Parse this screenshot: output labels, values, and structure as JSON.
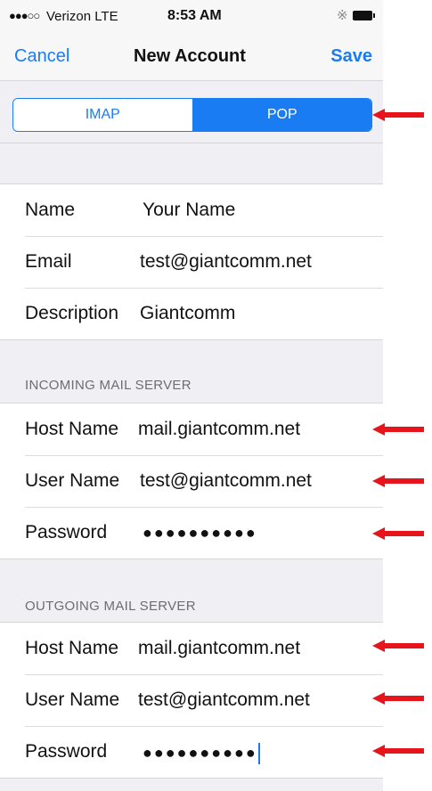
{
  "status": {
    "signal": "●●●○○",
    "carrier": "Verizon  LTE",
    "time": "8:53 AM",
    "bluetooth_icon": "bluetooth-icon",
    "battery_icon": "battery-icon"
  },
  "nav": {
    "cancel": "Cancel",
    "title": "New Account",
    "save": "Save"
  },
  "segment": {
    "options": [
      "IMAP",
      "POP"
    ],
    "selected": "POP"
  },
  "account": {
    "name_label": "Name",
    "name_value": "Your Name",
    "email_label": "Email",
    "email_value": "test@giantcomm.net",
    "description_label": "Description",
    "description_value": "Giantcomm"
  },
  "incoming": {
    "header": "INCOMING MAIL SERVER",
    "host_label": "Host Name",
    "host_value": "mail.giantcomm.net",
    "user_label": "User Name",
    "user_value": "test@giantcomm.net",
    "password_label": "Password",
    "password_value": "●●●●●●●●●●"
  },
  "outgoing": {
    "header": "OUTGOING MAIL SERVER",
    "host_label": "Host Name",
    "host_value": "mail.giantcomm.net",
    "user_label": "User Name",
    "user_value": "test@giantcomm.net",
    "password_label": "Password",
    "password_value": "●●●●●●●●●●"
  },
  "colors": {
    "accent": "#1a7cf2",
    "arrow": "#e8141c",
    "background": "#efeff4"
  }
}
